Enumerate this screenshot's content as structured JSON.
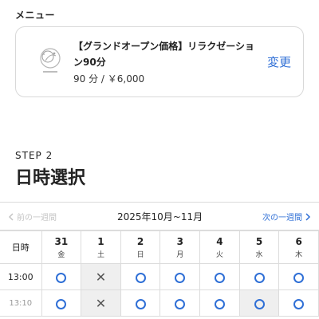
{
  "menu_section": {
    "label": "メニュー",
    "card": {
      "title": "【グランドオープン価格】リラクゼーション90分",
      "subtitle": "90 分 / ￥6,000",
      "change_label": "変更",
      "logo_icon": "relaxation-logo-icon"
    }
  },
  "step": {
    "label": "STEP 2",
    "title": "日時選択"
  },
  "week_nav": {
    "prev_label": "前の一週間",
    "range_label": "2025年10月~11月",
    "next_label": "次の一週間"
  },
  "calendar": {
    "time_header": "日時",
    "days": [
      {
        "num": "31",
        "wd": "金"
      },
      {
        "num": "1",
        "wd": "土"
      },
      {
        "num": "2",
        "wd": "日"
      },
      {
        "num": "3",
        "wd": "月"
      },
      {
        "num": "4",
        "wd": "火"
      },
      {
        "num": "5",
        "wd": "水"
      },
      {
        "num": "6",
        "wd": "木"
      }
    ],
    "rows": [
      {
        "time": "13:00",
        "slots": [
          "o",
          "x",
          "o",
          "o",
          "o",
          "o",
          "o"
        ]
      },
      {
        "time": "13:10",
        "slots": [
          "o",
          "x",
          "o",
          "o",
          "o",
          "o",
          "o"
        ]
      }
    ]
  },
  "colors": {
    "accent": "#2f6fd6",
    "border": "#dcdcdc",
    "unavailable_bg": "#efefef"
  }
}
